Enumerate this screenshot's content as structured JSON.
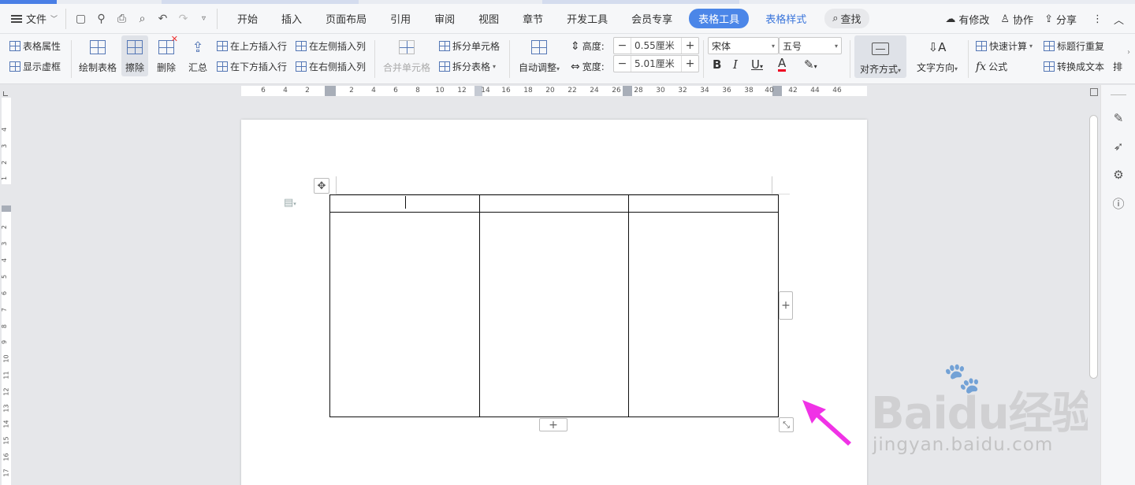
{
  "menubar": {
    "file": "文件",
    "tabs": [
      "开始",
      "插入",
      "页面布局",
      "引用",
      "审阅",
      "视图",
      "章节",
      "开发工具",
      "会员专享"
    ],
    "active_tab": "表格工具",
    "next_tab": "表格样式",
    "search": "查找",
    "right": {
      "changes": "有修改",
      "collab": "协作",
      "share": "分享"
    }
  },
  "ribbon": {
    "table_props": "表格属性",
    "show_gridlines": "显示虚框",
    "draw_table": "绘制表格",
    "erase": "擦除",
    "delete": "删除",
    "summary": "汇总",
    "insert_above": "在上方插入行",
    "insert_below": "在下方插入行",
    "insert_left": "在左侧插入列",
    "insert_right": "在右侧插入列",
    "merge_cells": "合并单元格",
    "split_cells": "拆分单元格",
    "split_table": "拆分表格",
    "auto_fit": "自动调整",
    "height_label": "高度:",
    "height_value": "0.55厘米",
    "width_label": "宽度:",
    "width_value": "5.01厘米",
    "font_name": "宋体",
    "font_size": "五号",
    "align": "对齐方式",
    "text_dir": "文字方向",
    "quick_calc": "快速计算",
    "formula": "公式",
    "header_repeat": "标题行重复",
    "convert_text": "转换成文本",
    "sort_partial": "排"
  },
  "hruler_ticks": [
    "6",
    "4",
    "2",
    "2",
    "4",
    "6",
    "8",
    "10",
    "12",
    "14",
    "16",
    "18",
    "20",
    "22",
    "24",
    "26",
    "28",
    "30",
    "32",
    "34",
    "36",
    "38",
    "40",
    "42",
    "44",
    "46"
  ],
  "vruler_ticks": [
    "4",
    "3",
    "2",
    "1",
    "2",
    "3",
    "4",
    "5",
    "6",
    "7",
    "8",
    "9",
    "10",
    "11",
    "12",
    "13",
    "14",
    "15",
    "16",
    "17"
  ],
  "watermark": {
    "logo": "Baidu经验",
    "url": "jingyan.baidu.com"
  },
  "colors": {
    "accent": "#4b86e8",
    "annotation_arrow": "#f032e6"
  }
}
